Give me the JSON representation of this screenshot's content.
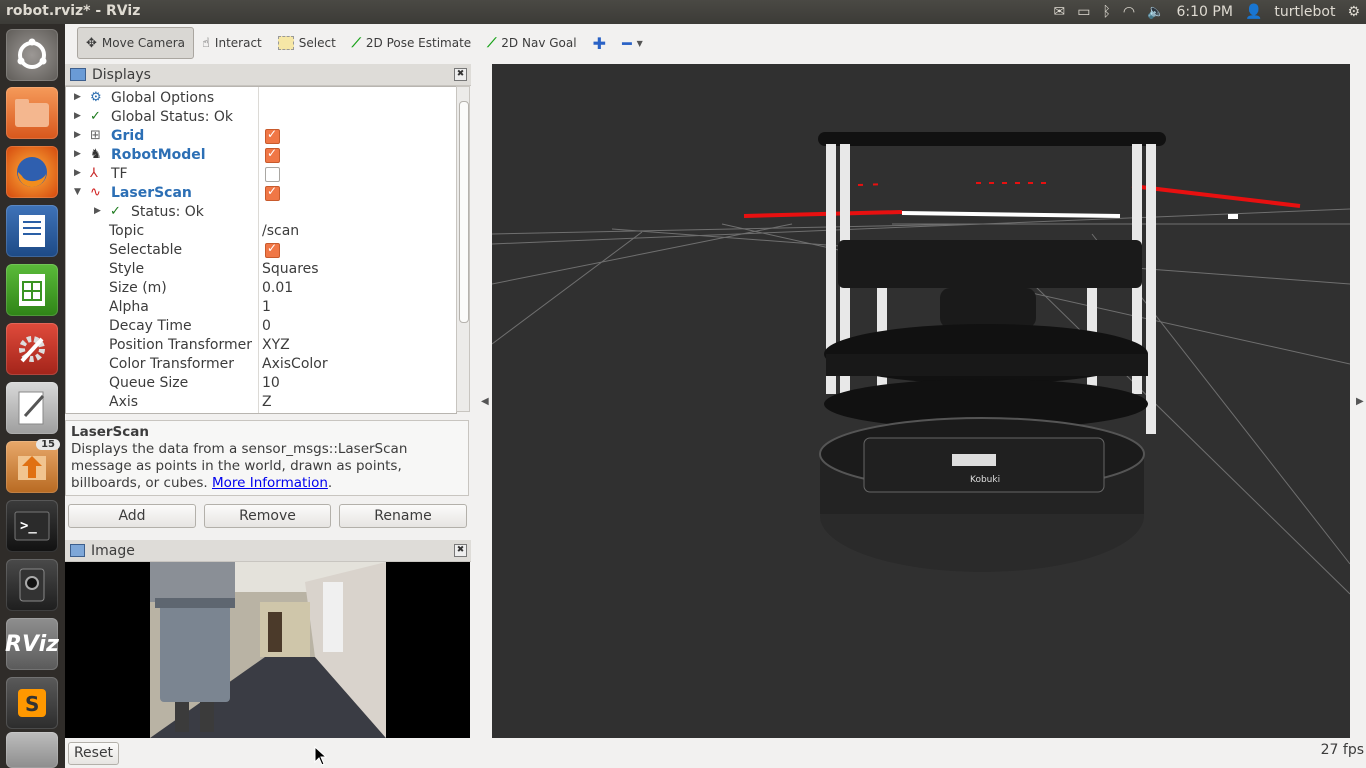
{
  "window": {
    "title": "robot.rviz* - RViz"
  },
  "top_panel": {
    "time": "6:10 PM",
    "user": "turtlebot"
  },
  "launcher": {
    "badge_count": "15",
    "rviz_label": "RViz"
  },
  "toolbar": {
    "move_camera": "Move Camera",
    "interact": "Interact",
    "select": "Select",
    "pose_estimate": "2D Pose Estimate",
    "nav_goal": "2D Nav Goal"
  },
  "displays": {
    "title": "Displays",
    "global_options": "Global Options",
    "global_status": "Global Status: Ok",
    "grid": "Grid",
    "robot_model": "RobotModel",
    "tf": "TF",
    "laser_scan": "LaserScan",
    "status_ok": "Status: Ok",
    "props": [
      {
        "key": "Topic",
        "value": "/scan"
      },
      {
        "key": "Selectable",
        "value": ""
      },
      {
        "key": "Style",
        "value": "Squares"
      },
      {
        "key": "Size (m)",
        "value": "0.01"
      },
      {
        "key": "Alpha",
        "value": "1"
      },
      {
        "key": "Decay Time",
        "value": "0"
      },
      {
        "key": "Position Transformer",
        "value": "XYZ"
      },
      {
        "key": "Color Transformer",
        "value": "AxisColor"
      },
      {
        "key": "Queue Size",
        "value": "10"
      },
      {
        "key": "Axis",
        "value": "Z"
      }
    ],
    "checkboxes": {
      "grid": true,
      "robot_model": true,
      "tf": false,
      "laser_scan": true,
      "selectable": true
    }
  },
  "description": {
    "title": "LaserScan",
    "text": "Displays the data from a sensor_msgs::LaserScan message as points in the world, drawn as points, billboards, or cubes.",
    "link": "More Information",
    "after_link": "."
  },
  "buttons": {
    "add": "Add",
    "remove": "Remove",
    "rename": "Rename"
  },
  "image_panel": {
    "title": "Image"
  },
  "robot_label": "Kobuki",
  "status": {
    "reset": "Reset",
    "fps": "27 fps"
  },
  "colors": {
    "laser_red": "#e81010",
    "checkbox": "#f07746",
    "link_blue": "#2c6fb5"
  }
}
